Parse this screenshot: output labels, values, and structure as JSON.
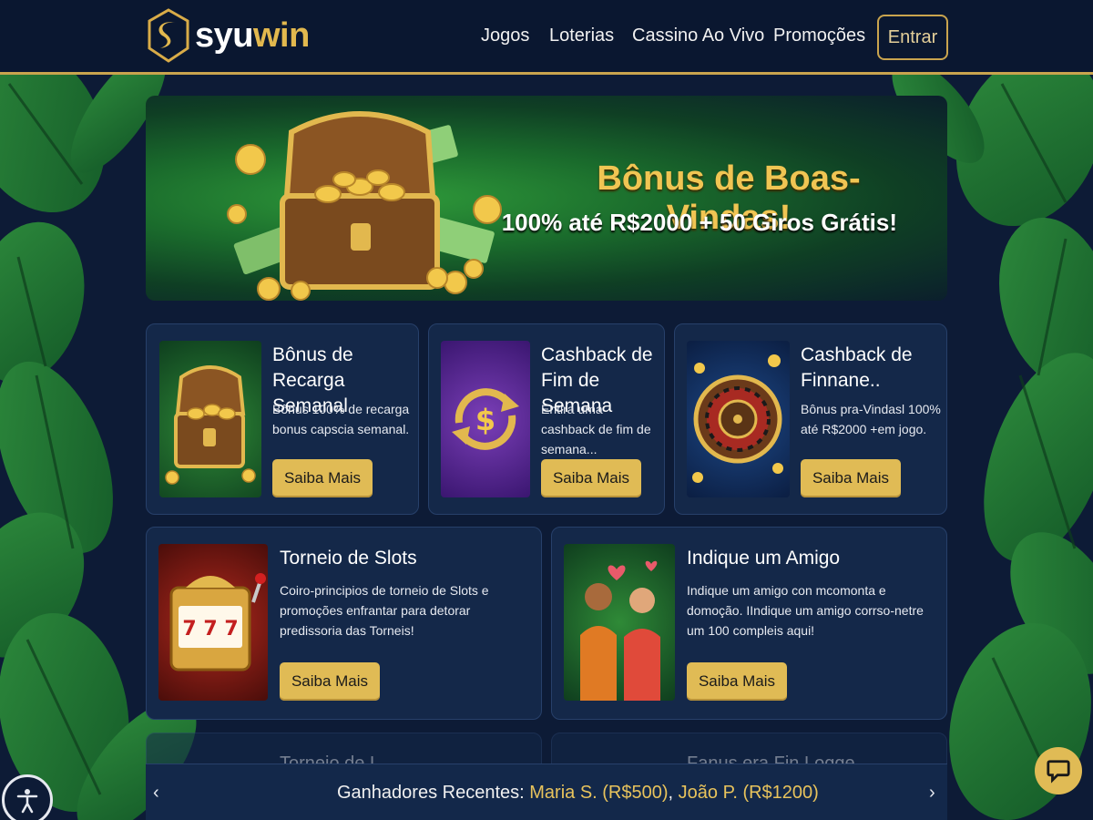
{
  "brand": {
    "name_part1": "syu",
    "name_part2": "win"
  },
  "nav": {
    "items": [
      "Jogos",
      "Loterias",
      "Cassino Ao Vivo",
      "Promoções"
    ],
    "login_label": "Entrar"
  },
  "hero": {
    "title": "Bônus de Boas-Vindas!",
    "subtitle": "100% até R$2000 + 50 Giros Grátis!"
  },
  "promos": [
    {
      "title": "Bônus de Recarga Semanal",
      "desc": "Bônus 100% de recarga bonus capscia semanal.",
      "button": "Saiba Mais",
      "icon": "treasure-chest-icon"
    },
    {
      "title": "Cashback de Fim de Semana",
      "desc": "Entira uma cashback de fim de semana...",
      "button": "Saiba Mais",
      "icon": "cashback-dollar-icon"
    },
    {
      "title": "Cashback de Finnane..",
      "desc": "Bônus pra-Vindasl 100% até R$2000 +em jogo.",
      "button": "Saiba Mais",
      "icon": "roulette-wheel-icon"
    },
    {
      "title": "Torneio de Slots",
      "desc": "Coiro-principios de torneio de Slots e promoções enfrantar para detorar predissoria das Torneis!",
      "button": "Saiba Mais",
      "icon": "slot-machine-icon"
    },
    {
      "title": "Indique um Amigo",
      "desc": "Indique um amigo con mcomonta e domoção. IIndique um amigo corrso-netre um 100 compleis aqui!",
      "button": "Saiba Mais",
      "icon": "friends-referral-icon"
    }
  ],
  "ghost_promos": [
    "Torneio de L...",
    "Fanus era Fin Logge..."
  ],
  "ticker": {
    "prefix": "Ganhadores Recentes:",
    "winner1": "Maria S. (R$500)",
    "separator": ",",
    "winner2": "João P. (R$1200)",
    "prev": "‹",
    "next": "›"
  },
  "colors": {
    "gold": "#e0bb55",
    "navy": "#0d1b36",
    "card": "#142849"
  }
}
